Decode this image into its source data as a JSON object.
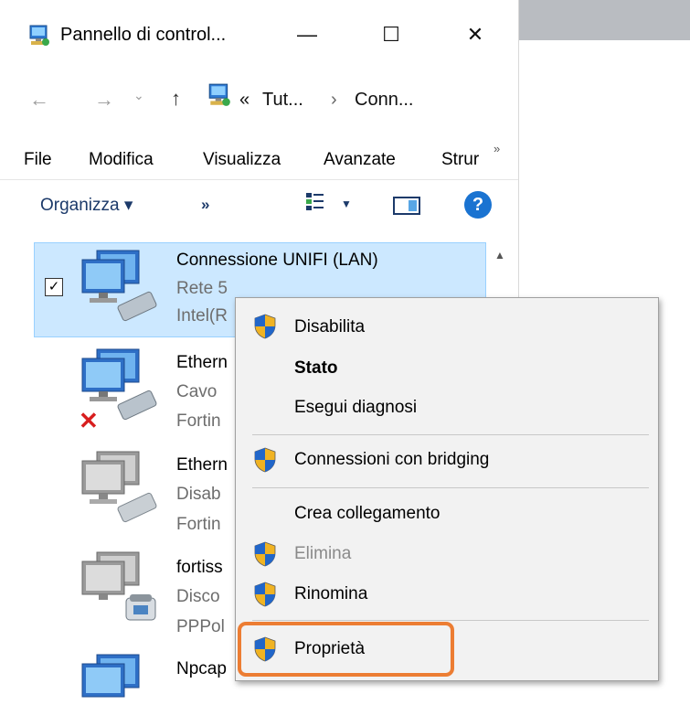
{
  "window": {
    "title": "Pannello di control...",
    "controls": {
      "minimize": "—",
      "maximize": "☐",
      "close": "✕"
    }
  },
  "address": {
    "back": "←",
    "forward": "→",
    "recent": "⌄",
    "up": "↑",
    "prefix": "«",
    "crumbs": [
      "Tut...",
      "›",
      "Conn..."
    ]
  },
  "menubar": {
    "items": [
      "File",
      "Modifica",
      "Visualizza",
      "Avanzate",
      "Strur"
    ],
    "more": "»"
  },
  "commandbar": {
    "organize": "Organizza ▾",
    "more": "»",
    "view_caret": "▼",
    "help": "?"
  },
  "items": [
    {
      "title": "Connessione UNIFI (LAN)",
      "line2": "Rete  5",
      "line3": "Intel(R",
      "selected": true,
      "checked": "✓",
      "status_icon": "cable-icon"
    },
    {
      "title": "Ethern",
      "line2": "Cavo",
      "line3": "Fortin",
      "selected": false,
      "status_icon": "disconnected-x-icon"
    },
    {
      "title": "Ethern",
      "line2": "Disab",
      "line3": "Fortin",
      "selected": false,
      "status_icon": "disabled-cable-icon"
    },
    {
      "title": "fortiss",
      "line2": "Disco",
      "line3": "PPPol",
      "selected": false,
      "status_icon": "phone-icon"
    },
    {
      "title": "Npcap",
      "line2": "",
      "line3": "",
      "selected": false,
      "status_icon": "cable-icon"
    }
  ],
  "context_menu": {
    "items": [
      {
        "label": "Disabilita",
        "shield": true
      },
      {
        "label": "Stato",
        "bold": true
      },
      {
        "label": "Esegui diagnosi"
      },
      {
        "label": "Connessioni con bridging",
        "shield": true
      },
      {
        "label": "Crea collegamento"
      },
      {
        "label": "Elimina",
        "shield": true,
        "disabled": true
      },
      {
        "label": "Rinomina",
        "shield": true
      },
      {
        "label": "Proprietà",
        "shield": true,
        "highlighted": true
      }
    ]
  },
  "colors": {
    "selection": "#cce8ff",
    "highlight_border": "#ec7d33",
    "help_blue": "#1a73d1"
  }
}
